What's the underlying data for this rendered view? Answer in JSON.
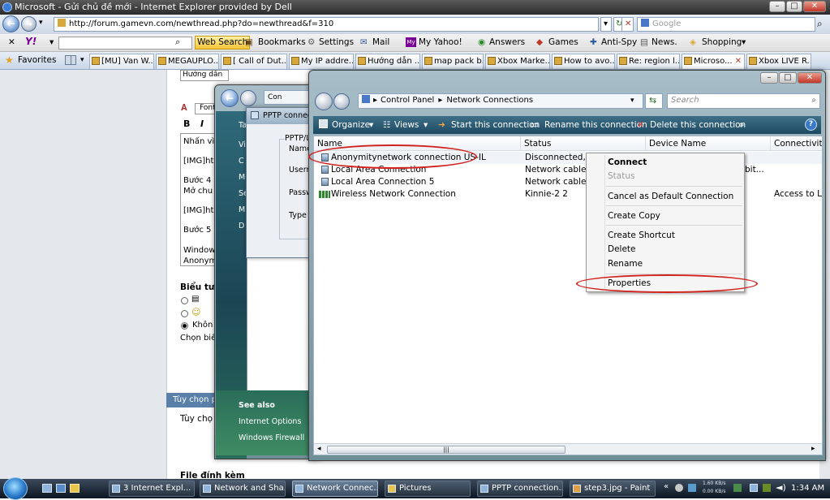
{
  "ie": {
    "title": "Microsoft - Gửi chủ đề mới - Internet Explorer provided by Dell",
    "window_controls": {
      "minimize": "–",
      "maximize": "□",
      "close": "✕"
    },
    "address": "http://forum.gamevn.com/newthread.php?do=newthread&f=310",
    "search_placeholder": "Google",
    "address_buttons": {
      "dropdown": "▾",
      "refresh": "↻",
      "stop": "✕",
      "search_go": "⌕"
    }
  },
  "yahoo_toolbar": {
    "close": "✕",
    "logo": "Y!",
    "search_button": "Web Search",
    "items": [
      {
        "label": "Bookmarks"
      },
      {
        "label": "Settings"
      },
      {
        "label": "Mail"
      },
      {
        "label": "My Yahoo!"
      },
      {
        "label": "Answers"
      },
      {
        "label": "Games"
      },
      {
        "label": "Anti-Spy"
      },
      {
        "label": "News."
      },
      {
        "label": "Shopping"
      }
    ]
  },
  "tabs": {
    "favorites": "Favorites",
    "items": [
      {
        "label": "[MU] Van W..."
      },
      {
        "label": "MEGAUPLO..."
      },
      {
        "label": "[ Call of Dut..."
      },
      {
        "label": "My IP addre..."
      },
      {
        "label": "Hướng dẫn ..."
      },
      {
        "label": "map pack b..."
      },
      {
        "label": "Xbox Marke..."
      },
      {
        "label": "How to avo..."
      },
      {
        "label": "Re: region l..."
      },
      {
        "label": "Microso..."
      },
      {
        "label": "Xbox LIVE R..."
      }
    ]
  },
  "forum": {
    "input_text": "Hướng dẫn",
    "font_label": "Font",
    "bold": "B",
    "italic": "I",
    "editor_lines": [
      "Nhấn vì",
      "[IMG]ht",
      "Bước 4",
      "Mở chu",
      "[IMG]ht",
      "Bước 5",
      "Window",
      "Anonym"
    ],
    "icons_heading": "Biểu tư",
    "radio_none": "Khôn",
    "choose_text": "Chọn biể",
    "options_header": "Tùy chọn p",
    "options_text": "Tùy chọ",
    "attachments_heading": "File đính kèm"
  },
  "back_window": {
    "address_text": "Con",
    "side_items": [
      "Ta",
      "Vi",
      "C",
      "M",
      "Se",
      "M",
      "D"
    ],
    "see_also": "See also",
    "links": [
      "Internet Options",
      "Windows Firewall"
    ]
  },
  "pptp_window": {
    "title": "PPTP connec",
    "group_label": "PPTP/L",
    "fields": [
      "Name",
      "Userna",
      "Passw",
      "Type"
    ]
  },
  "net_window": {
    "breadcrumb": [
      "Control Panel",
      "Network Connections"
    ],
    "search_placeholder": "Search",
    "window_controls": {
      "minimize": "–",
      "maximize": "□",
      "close": "✕"
    },
    "commands": [
      "Organize",
      "Views",
      "Start this connection",
      "Rename this connection",
      "Delete this connection",
      "»"
    ],
    "help": "?",
    "columns": [
      "Name",
      "Status",
      "Device Name",
      "Connectivity"
    ],
    "rows": [
      {
        "name": "Anonymitynetwork connection US-IL",
        "status": "Disconnected, Sha",
        "device": "",
        "connectivity": ""
      },
      {
        "name": "Local Area Connection",
        "status": "Network cable un",
        "device": "bit...",
        "connectivity": ""
      },
      {
        "name": "Local Area Connection 5",
        "status": "Network cable un",
        "device": "",
        "connectivity": ""
      },
      {
        "name": "Wireless Network Connection",
        "status": "Kinnie-2  2",
        "device": "",
        "connectivity": "Access to Loc"
      }
    ],
    "scroll_grip": "|||"
  },
  "context_menu": {
    "items": [
      "Connect",
      "Status",
      "Cancel as Default Connection",
      "Create Copy",
      "Create Shortcut",
      "Delete",
      "Rename",
      "Properties"
    ]
  },
  "taskbar": {
    "buttons": [
      {
        "label": "3 Internet Expl..."
      },
      {
        "label": "Network and Sha..."
      },
      {
        "label": "Network Connec..."
      },
      {
        "label": "Pictures"
      },
      {
        "label": "PPTP connection..."
      },
      {
        "label": "step3.jpg - Paint"
      }
    ],
    "time": "1:34 AM",
    "net_speed": "1.60 KB/s\n0.00 KB/s"
  },
  "colors": {
    "annotation_red": "#d0231f",
    "cmdbar": "#2a5a74",
    "taskbar": "#1b2633"
  }
}
